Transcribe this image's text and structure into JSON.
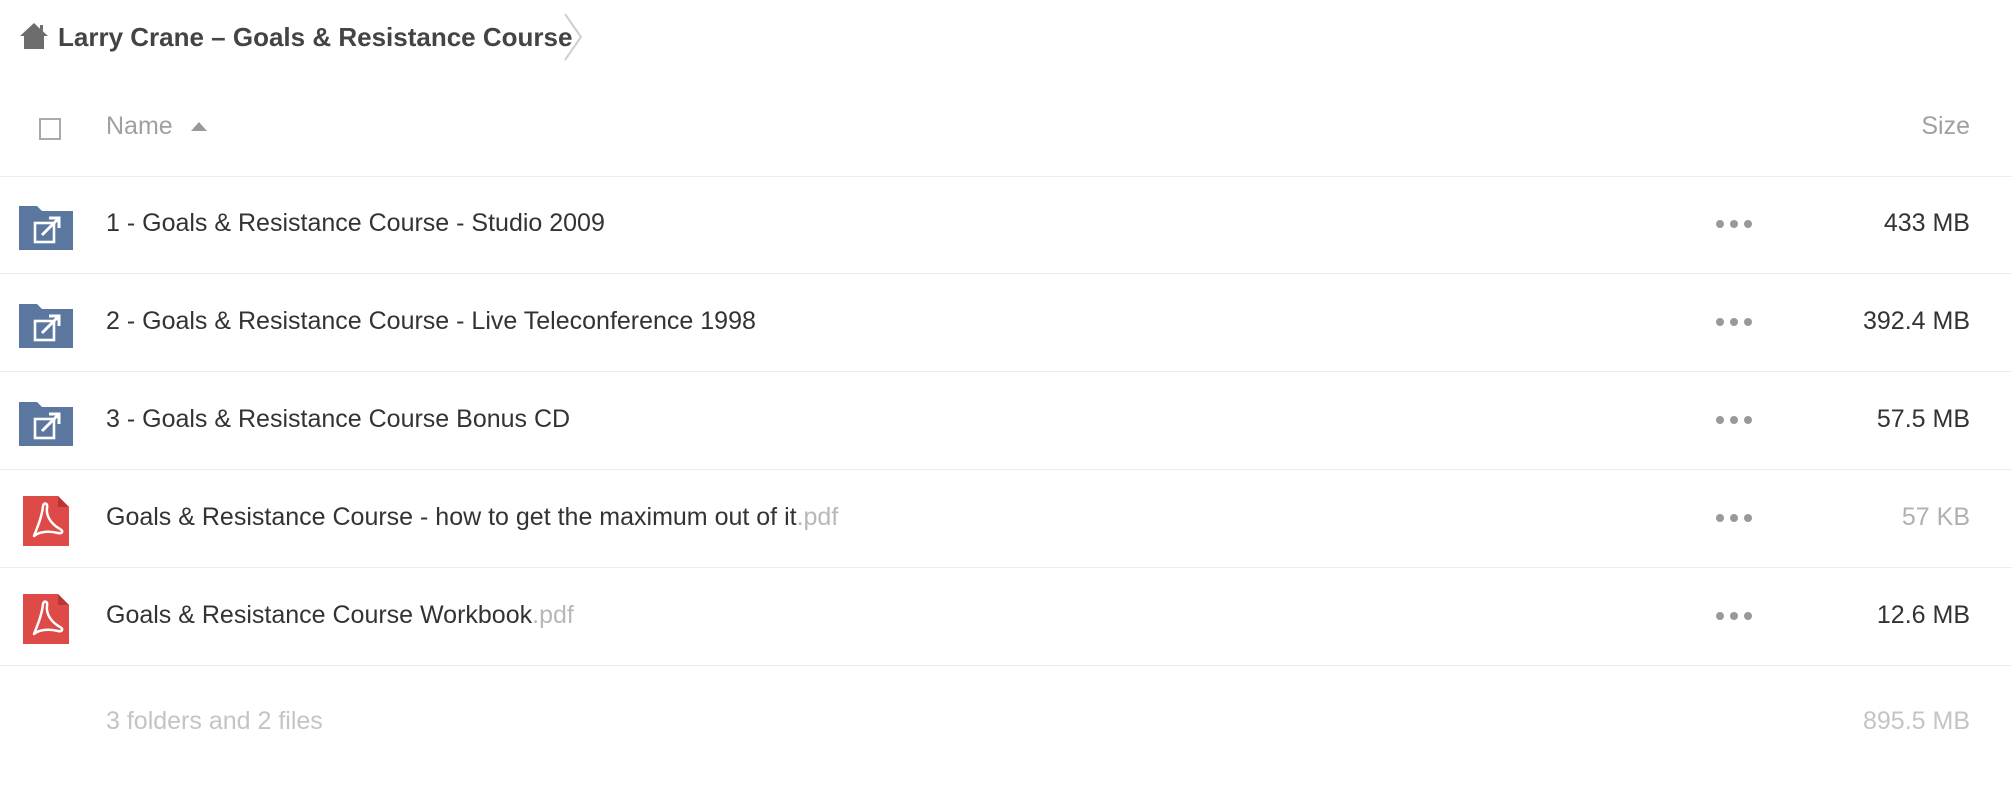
{
  "breadcrumb": {
    "title": "Larry Crane – Goals & Resistance Course"
  },
  "table": {
    "name_header": "Name",
    "size_header": "Size",
    "rows": [
      {
        "name": "1 - Goals & Resistance Course - Studio 2009",
        "ext": "",
        "size": "433 MB",
        "type": "shared-folder"
      },
      {
        "name": "2 - Goals & Resistance Course - Live Teleconference 1998",
        "ext": "",
        "size": "392.4 MB",
        "type": "shared-folder"
      },
      {
        "name": "3 - Goals & Resistance Course Bonus CD",
        "ext": "",
        "size": "57.5 MB",
        "type": "shared-folder"
      },
      {
        "name": "Goals & Resistance Course - how to get the maximum out of it",
        "ext": ".pdf",
        "size": "57 KB",
        "type": "pdf"
      },
      {
        "name": "Goals & Resistance Course Workbook",
        "ext": ".pdf",
        "size": "12.6 MB",
        "type": "pdf"
      }
    ]
  },
  "summary": {
    "text": "3 folders and 2 files",
    "total": "895.5 MB"
  },
  "colors": {
    "folder": "#5b77a0",
    "pdf": "#dd4a48"
  },
  "icons": {
    "home": "home-icon",
    "folder": "shared-folder-icon",
    "pdf": "pdf-icon",
    "menu": "more-icon"
  }
}
